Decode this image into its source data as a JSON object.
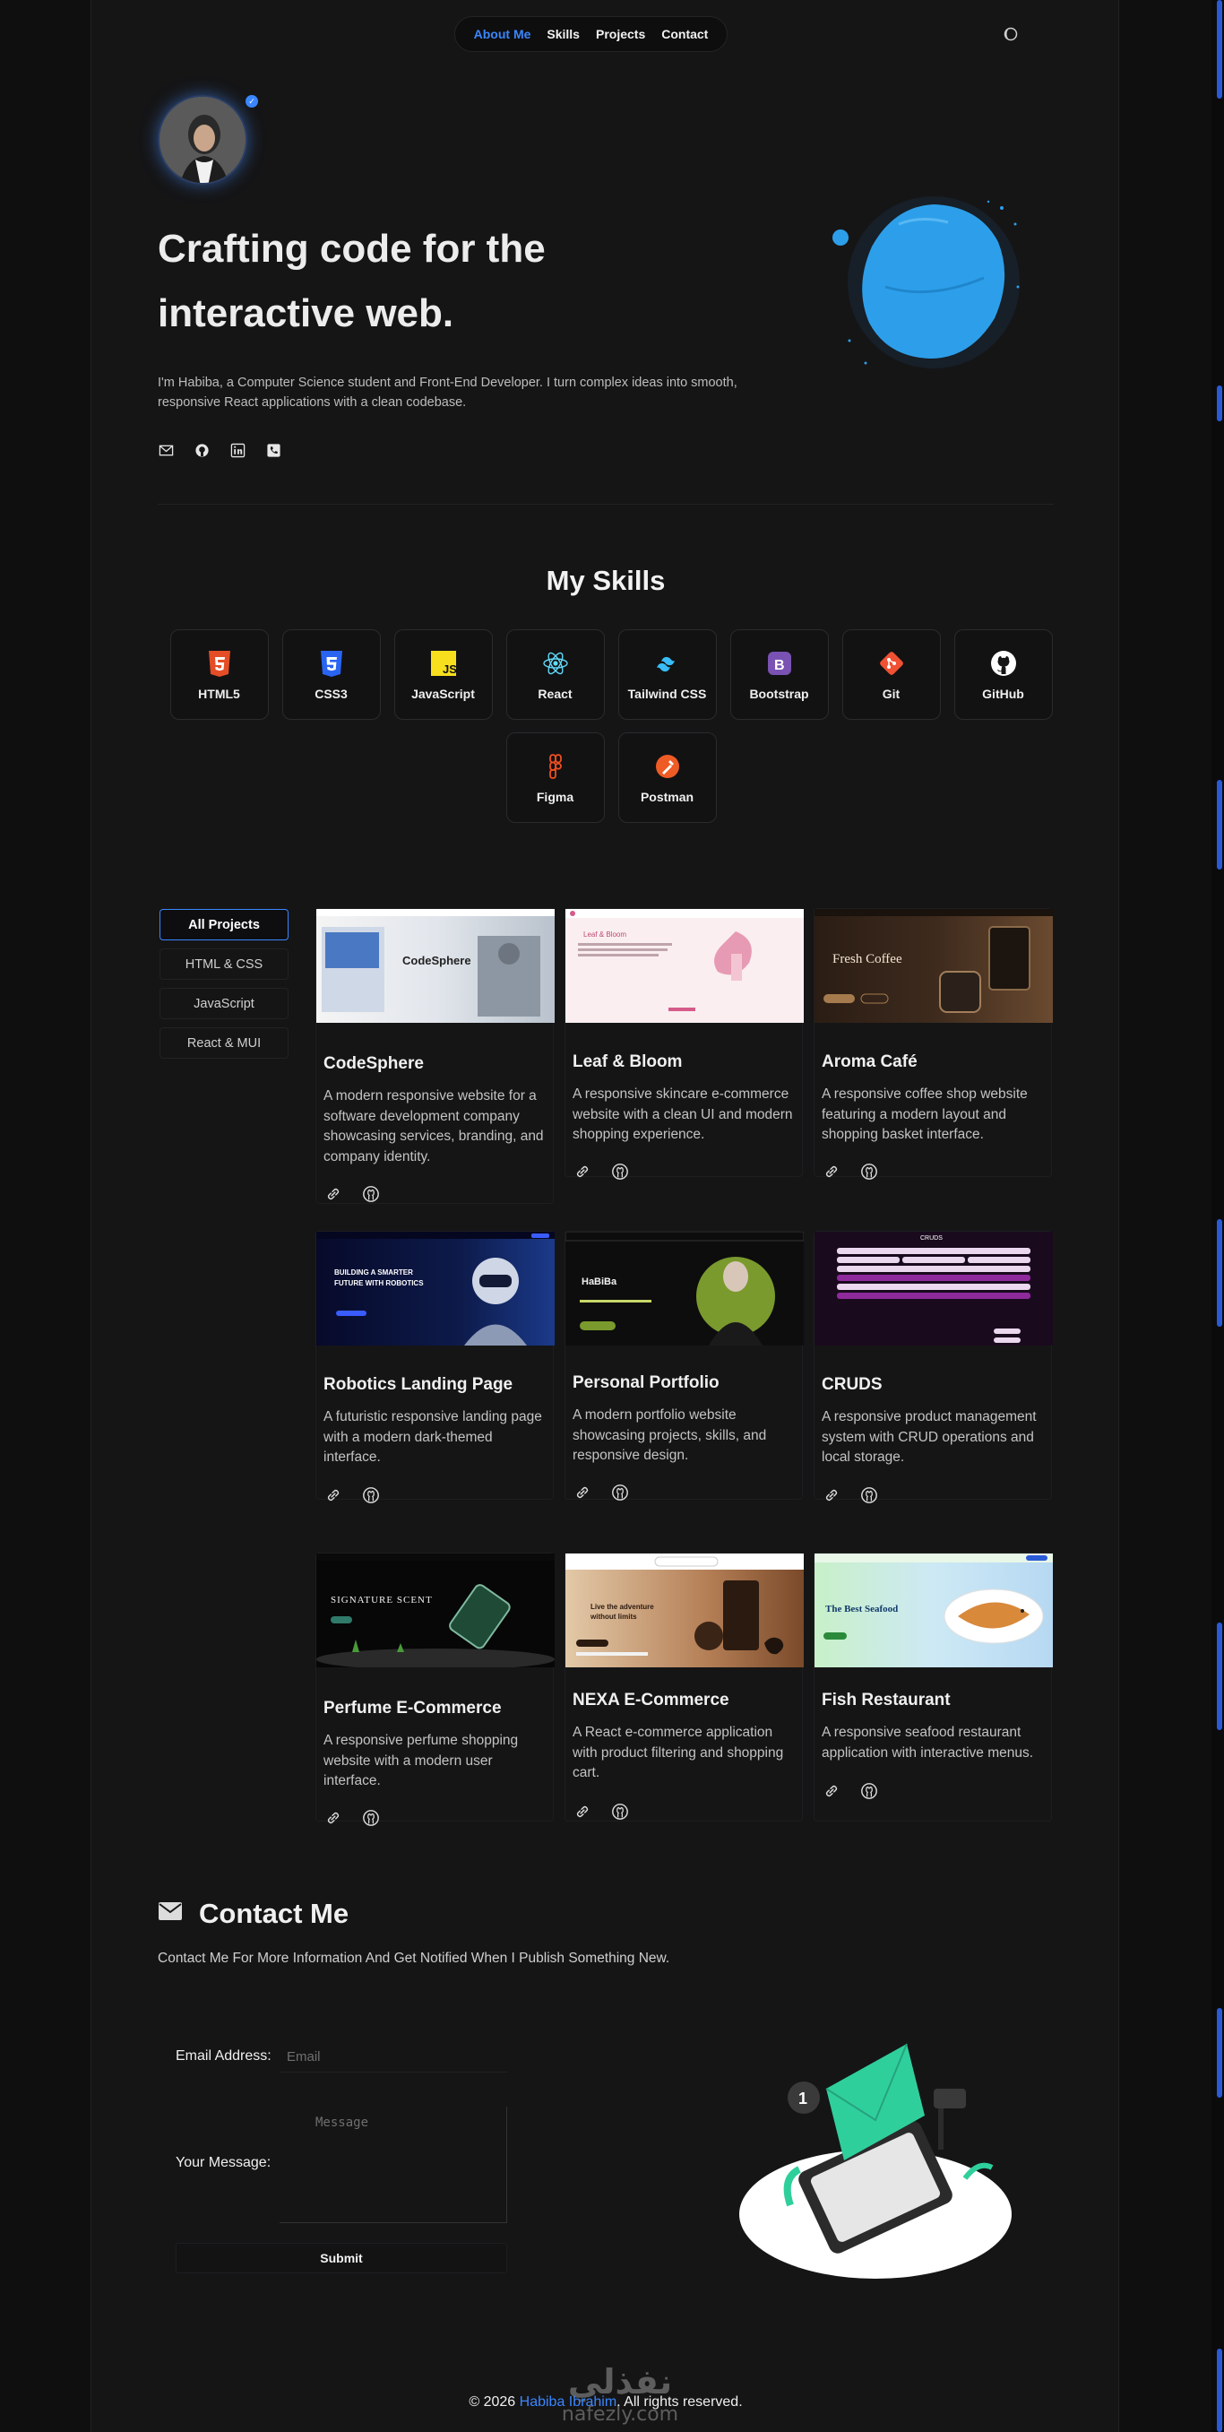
{
  "nav": {
    "items": [
      "About Me",
      "Skills",
      "Projects",
      "Contact"
    ],
    "active": "About Me"
  },
  "hero": {
    "title": "Crafting code for the interactive web.",
    "description": "I'm Habiba, a Computer Science student and Front-End Developer. I turn complex ideas into smooth, responsive React applications with a clean codebase.",
    "socials": [
      "mail-icon",
      "github-icon",
      "linkedin-icon",
      "phone-icon"
    ]
  },
  "skills": {
    "title": "My Skills",
    "items": [
      {
        "name": "HTML5",
        "icon": "html5-icon"
      },
      {
        "name": "CSS3",
        "icon": "css3-icon"
      },
      {
        "name": "JavaScript",
        "icon": "javascript-icon"
      },
      {
        "name": "React",
        "icon": "react-icon"
      },
      {
        "name": "Tailwind CSS",
        "icon": "tailwind-icon"
      },
      {
        "name": "Bootstrap",
        "icon": "bootstrap-icon"
      },
      {
        "name": "Git",
        "icon": "git-icon"
      },
      {
        "name": "GitHub",
        "icon": "github-icon"
      },
      {
        "name": "Figma",
        "icon": "figma-icon"
      },
      {
        "name": "Postman",
        "icon": "postman-icon"
      }
    ]
  },
  "filters": [
    "All Projects",
    "HTML & CSS",
    "JavaScript",
    "React & MUI"
  ],
  "projects": [
    {
      "title": "CodeSphere",
      "desc": "A modern responsive website for a software development company showcasing services, branding, and company identity.",
      "thumb_text": "CodeSphere"
    },
    {
      "title": "Leaf & Bloom",
      "desc": "A responsive skincare e-commerce website with a clean UI and modern shopping experience.",
      "thumb_text": "Leaf & Bloom"
    },
    {
      "title": "Aroma Café",
      "desc": "A responsive coffee shop website featuring a modern layout and shopping basket interface.",
      "thumb_text": "Fresh Coffee"
    },
    {
      "title": "Robotics Landing Page",
      "desc": "A futuristic responsive landing page with a modern dark-themed interface.",
      "thumb_text": "BUILDING A SMARTER FUTURE WITH ROBOTICS"
    },
    {
      "title": "Personal Portfolio",
      "desc": "A modern portfolio website showcasing projects, skills, and responsive design.",
      "thumb_text": "HaBiBa"
    },
    {
      "title": "CRUDS",
      "desc": "A responsive product management system with CRUD operations and local storage.",
      "thumb_text": "CRUDS"
    },
    {
      "title": "Perfume E-Commerce",
      "desc": "A responsive perfume shopping website with a modern user interface.",
      "thumb_text": "SIGNATURE SCENT"
    },
    {
      "title": "NEXA E-Commerce",
      "desc": "A React e-commerce application with product filtering and shopping cart.",
      "thumb_text": "Live the adventure without limits"
    },
    {
      "title": "Fish Restaurant",
      "desc": "A responsive seafood restaurant application with interactive menus.",
      "thumb_text": "The Best Seafood"
    }
  ],
  "contact": {
    "title": "Contact Me",
    "subtitle": "Contact Me For More Information And Get Notified When I Publish Something New.",
    "email_label": "Email Address:",
    "email_placeholder": "Email",
    "message_label": "Your Message:",
    "message_placeholder": "Message",
    "submit_label": "Submit"
  },
  "footer": {
    "prefix": "© 2026",
    "name": "Habiba Ibrahim",
    "suffix": ". All rights reserved."
  },
  "watermark": {
    "text_ar": "نفذلي",
    "text": "nafezly.com"
  },
  "colors": {
    "accent": "#3a86ff",
    "background": "#151516"
  }
}
